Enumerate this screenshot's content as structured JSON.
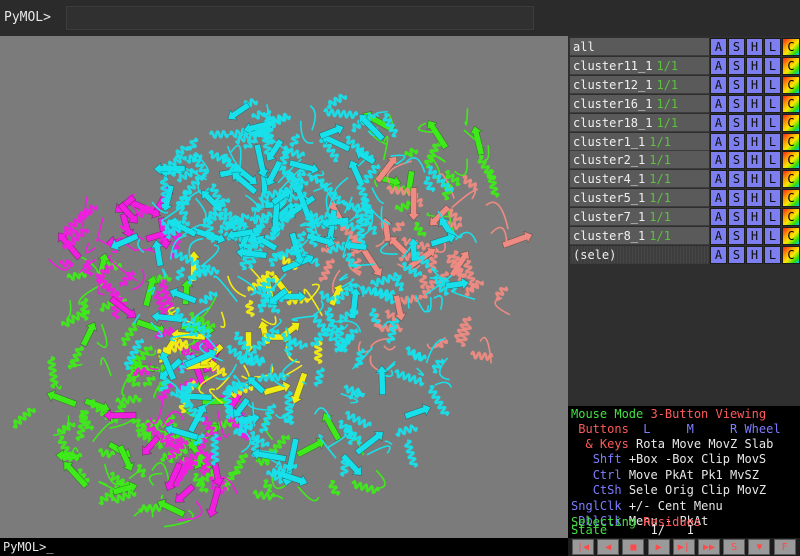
{
  "top": {
    "prompt": "PyMOL>"
  },
  "bottom": {
    "prompt": "PyMOL>_"
  },
  "objects": [
    {
      "name": "all",
      "state": ""
    },
    {
      "name": "cluster11_1",
      "state": "1/1"
    },
    {
      "name": "cluster12_1",
      "state": "1/1"
    },
    {
      "name": "cluster16_1",
      "state": "1/1"
    },
    {
      "name": "cluster18_1",
      "state": "1/1"
    },
    {
      "name": "cluster1_1",
      "state": "1/1"
    },
    {
      "name": "cluster2_1",
      "state": "1/1"
    },
    {
      "name": "cluster4_1",
      "state": "1/1"
    },
    {
      "name": "cluster5_1",
      "state": "1/1"
    },
    {
      "name": "cluster7_1",
      "state": "1/1"
    },
    {
      "name": "cluster8_1",
      "state": "1/1"
    },
    {
      "name": "(sele)",
      "state": ""
    }
  ],
  "object_buttons": {
    "a": "A",
    "s": "S",
    "h": "H",
    "l": "L",
    "c": "C"
  },
  "mouse": {
    "title_left": "Mouse Mode",
    "title_right": "3-Button Viewing",
    "buttons_label": "Buttons",
    "col_l": "L",
    "col_m": "M",
    "col_r": "R",
    "col_wheel": "Wheel",
    "rows": [
      {
        "label": "& Keys",
        "l": "Rota",
        "m": "Move",
        "r": "MovZ",
        "w": "Slab"
      },
      {
        "label": "Shft",
        "l": "+Box",
        "m": "-Box",
        "r": "Clip",
        "w": "MovS"
      },
      {
        "label": "Ctrl",
        "l": "Move",
        "m": "PkAt",
        "r": "Pk1",
        "w": "MvSZ"
      },
      {
        "label": "CtSh",
        "l": "Sele",
        "m": "Orig",
        "r": "Clip",
        "w": "MovZ"
      },
      {
        "label": "SnglClk",
        "l": "+/-",
        "m": "Cent",
        "r": "Menu",
        "w": ""
      },
      {
        "label": "DblClk",
        "l": "Menu",
        "m": "-",
        "r": "PkAt",
        "w": ""
      }
    ],
    "selecting_label": "Selecting",
    "selecting_value": "Residues",
    "state_label": "State",
    "state_current": "1/",
    "state_total": "1"
  },
  "movie_controls": [
    "|◀",
    "◀",
    "■",
    "▶",
    "▶|",
    "▶▶",
    "S",
    "▼",
    "F"
  ],
  "colors": {
    "cyan": "#18e0ea",
    "green": "#3fea1a",
    "magenta": "#f11ee0",
    "salmon": "#ee8b82",
    "yellow": "#f2ec15",
    "background": "#7b7b7b"
  }
}
